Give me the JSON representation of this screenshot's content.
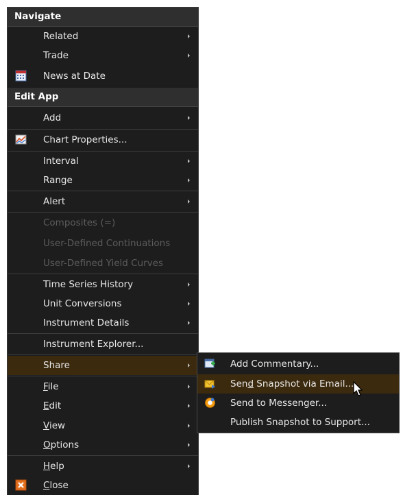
{
  "context_menu": {
    "navigate": {
      "header": "Navigate",
      "related": "Related",
      "trade": "Trade",
      "news_at_date": "News at Date"
    },
    "edit_app": {
      "header": "Edit App",
      "add": "Add",
      "chart_properties": "Chart Properties...",
      "interval": "Interval",
      "range": "Range",
      "alert": "Alert",
      "composites": "Composites (=)",
      "user_defined_continuations": "User-Defined Continuations",
      "user_defined_yield_curves": "User-Defined Yield Curves",
      "time_series_history": "Time Series History",
      "unit_conversions": "Unit Conversions",
      "instrument_details": "Instrument Details",
      "instrument_explorer": "Instrument Explorer...",
      "share": "Share",
      "file": {
        "pre": "",
        "key": "F",
        "post": "ile"
      },
      "edit": {
        "pre": "",
        "key": "E",
        "post": "dit"
      },
      "view": {
        "pre": "",
        "key": "V",
        "post": "iew"
      },
      "options": {
        "pre": "",
        "key": "O",
        "post": "ptions"
      },
      "help": {
        "pre": "",
        "key": "H",
        "post": "elp"
      },
      "close": {
        "pre": "",
        "key": "C",
        "post": "lose"
      }
    }
  },
  "share_submenu": {
    "add_commentary": "Add Commentary...",
    "send_snapshot_email": {
      "pre": "Sen",
      "key": "d",
      "post": " Snapshot via Email..."
    },
    "send_to_messenger": "Send to Messenger...",
    "publish_snapshot_support": "Publish Snapshot to Support..."
  },
  "colors": {
    "menu_bg": "#1d1d1d",
    "header_bg": "#2f2f2f",
    "highlight": "#3c2a0e",
    "text": "#e8e8e8",
    "disabled_text": "#5c5c5c"
  },
  "icons": {
    "news_at_date": "calendar-icon",
    "chart_properties": "chart-icon",
    "close": "close-icon",
    "add_commentary": "commentary-icon",
    "send_snapshot_email": "email-icon",
    "send_to_messenger": "messenger-icon"
  }
}
